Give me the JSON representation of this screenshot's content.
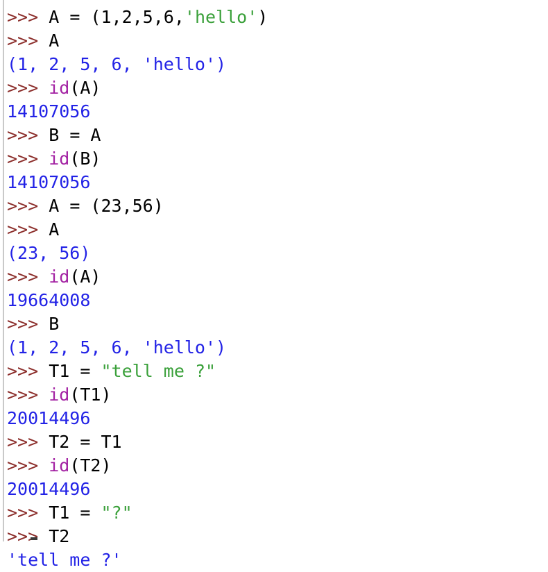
{
  "app": {
    "kind": "python-interactive-shell",
    "prompt": ">>> "
  },
  "colors": {
    "background": "#ffffff",
    "prompt": "#8c2e2b",
    "code": "#000000",
    "string": "#3aa03a",
    "builtin": "#a322a3",
    "output": "#2222e6",
    "left_rule": "#b9b9b9"
  },
  "session": {
    "lines": [
      {
        "kind": "input",
        "tokens": [
          {
            "t": "prompt",
            "v": ">>> "
          },
          {
            "t": "code",
            "v": "A = (1,2,5,6,"
          },
          {
            "t": "string",
            "v": "'hello'"
          },
          {
            "t": "code",
            "v": ")"
          }
        ]
      },
      {
        "kind": "input",
        "tokens": [
          {
            "t": "prompt",
            "v": ">>> "
          },
          {
            "t": "code",
            "v": "A"
          }
        ]
      },
      {
        "kind": "output",
        "tokens": [
          {
            "t": "output",
            "v": "(1, 2, 5, 6, 'hello')"
          }
        ]
      },
      {
        "kind": "input",
        "tokens": [
          {
            "t": "prompt",
            "v": ">>> "
          },
          {
            "t": "builtin",
            "v": "id"
          },
          {
            "t": "code",
            "v": "(A)"
          }
        ]
      },
      {
        "kind": "output",
        "tokens": [
          {
            "t": "output",
            "v": "14107056"
          }
        ]
      },
      {
        "kind": "input",
        "tokens": [
          {
            "t": "prompt",
            "v": ">>> "
          },
          {
            "t": "code",
            "v": "B = A"
          }
        ]
      },
      {
        "kind": "input",
        "tokens": [
          {
            "t": "prompt",
            "v": ">>> "
          },
          {
            "t": "builtin",
            "v": "id"
          },
          {
            "t": "code",
            "v": "(B)"
          }
        ]
      },
      {
        "kind": "output",
        "tokens": [
          {
            "t": "output",
            "v": "14107056"
          }
        ]
      },
      {
        "kind": "input",
        "tokens": [
          {
            "t": "prompt",
            "v": ">>> "
          },
          {
            "t": "code",
            "v": "A = (23,56)"
          }
        ]
      },
      {
        "kind": "input",
        "tokens": [
          {
            "t": "prompt",
            "v": ">>> "
          },
          {
            "t": "code",
            "v": "A"
          }
        ]
      },
      {
        "kind": "output",
        "tokens": [
          {
            "t": "output",
            "v": "(23, 56)"
          }
        ]
      },
      {
        "kind": "input",
        "tokens": [
          {
            "t": "prompt",
            "v": ">>> "
          },
          {
            "t": "builtin",
            "v": "id"
          },
          {
            "t": "code",
            "v": "(A)"
          }
        ]
      },
      {
        "kind": "output",
        "tokens": [
          {
            "t": "output",
            "v": "19664008"
          }
        ]
      },
      {
        "kind": "input",
        "tokens": [
          {
            "t": "prompt",
            "v": ">>> "
          },
          {
            "t": "code",
            "v": "B"
          }
        ]
      },
      {
        "kind": "output",
        "tokens": [
          {
            "t": "output",
            "v": "(1, 2, 5, 6, 'hello')"
          }
        ]
      },
      {
        "kind": "input",
        "tokens": [
          {
            "t": "prompt",
            "v": ">>> "
          },
          {
            "t": "code",
            "v": "T1 = "
          },
          {
            "t": "string",
            "v": "\"tell me ?\""
          }
        ]
      },
      {
        "kind": "input",
        "tokens": [
          {
            "t": "prompt",
            "v": ">>> "
          },
          {
            "t": "builtin",
            "v": "id"
          },
          {
            "t": "code",
            "v": "(T1)"
          }
        ]
      },
      {
        "kind": "output",
        "tokens": [
          {
            "t": "output",
            "v": "20014496"
          }
        ]
      },
      {
        "kind": "input",
        "tokens": [
          {
            "t": "prompt",
            "v": ">>> "
          },
          {
            "t": "code",
            "v": "T2 = T1"
          }
        ]
      },
      {
        "kind": "input",
        "tokens": [
          {
            "t": "prompt",
            "v": ">>> "
          },
          {
            "t": "builtin",
            "v": "id"
          },
          {
            "t": "code",
            "v": "(T2)"
          }
        ]
      },
      {
        "kind": "output",
        "tokens": [
          {
            "t": "output",
            "v": "20014496"
          }
        ]
      },
      {
        "kind": "input",
        "tokens": [
          {
            "t": "prompt",
            "v": ">>> "
          },
          {
            "t": "code",
            "v": "T1 = "
          },
          {
            "t": "string",
            "v": "\"?\""
          }
        ]
      },
      {
        "kind": "input",
        "tokens": [
          {
            "t": "prompt",
            "v": ">>> "
          },
          {
            "t": "code",
            "v": "T2"
          }
        ]
      },
      {
        "kind": "output",
        "tokens": [
          {
            "t": "output",
            "v": "'tell me ?'"
          }
        ]
      }
    ]
  }
}
